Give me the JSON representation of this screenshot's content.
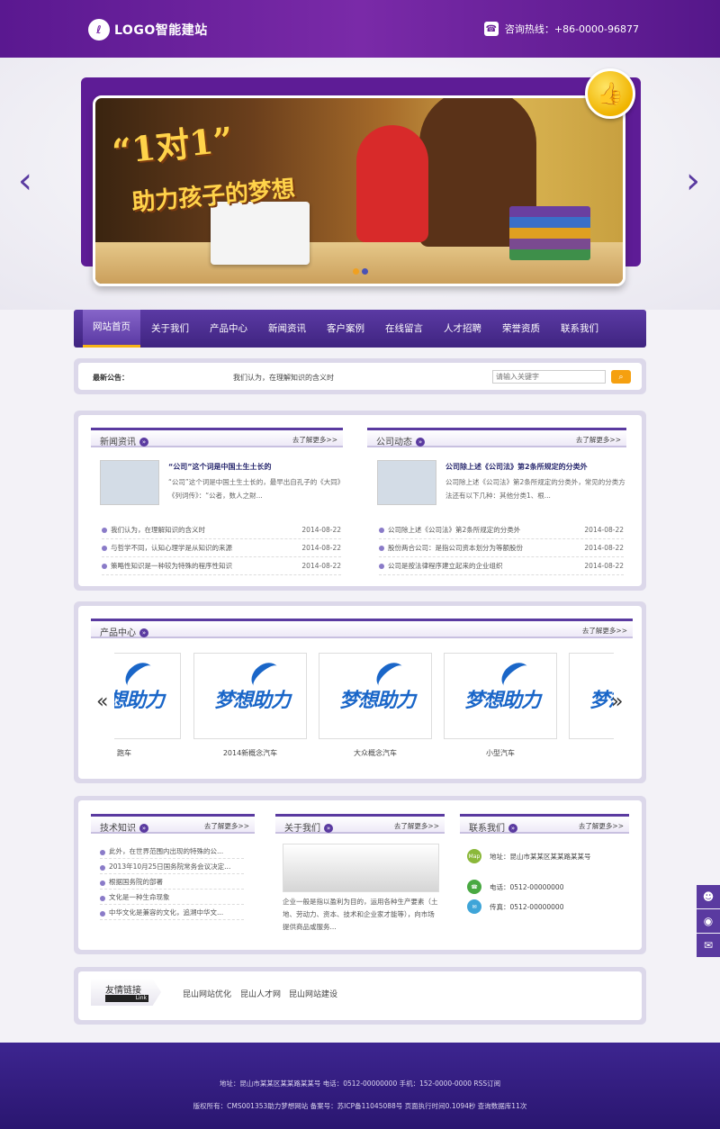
{
  "header": {
    "logo_text": "LOGO智能建站",
    "hotline": "咨询热线：+86-0000-96877"
  },
  "nav": {
    "items": [
      "网站首页",
      "关于我们",
      "产品中心",
      "新闻资讯",
      "客户案例",
      "在线留言",
      "人才招聘",
      "荣誉资质",
      "联系我们"
    ],
    "active": "网站首页"
  },
  "notice": {
    "label": "最新公告：",
    "text": "我们认为，在理解知识的含义时",
    "search_placeholder": "请输入关键字"
  },
  "news": {
    "title": "新闻资讯",
    "more": "去了解更多>>",
    "feature_title": "“公司”这个词是中国土生土长的",
    "feature_desc": "“公司”这个词是中国土生土长的，最早出自孔子的《大同》《列词传》：“公者，数人之財...",
    "items": [
      {
        "text": "我们认为，在理解知识的含义时",
        "date": "2014-08-22"
      },
      {
        "text": "与哲学不同，认知心理学是从知识的来源",
        "date": "2014-08-22"
      },
      {
        "text": "策略性知识是一种较为特殊的程序性知识",
        "date": "2014-08-22"
      }
    ]
  },
  "company": {
    "title": "公司动态",
    "more": "去了解更多>>",
    "feature_title": "公司除上述《公司法》第2条所规定的分类外",
    "feature_desc": "公司除上述《公司法》第2条所规定的分类外，常见的分类方法还有以下几种：其他分类1、根...",
    "items": [
      {
        "text": "公司除上述《公司法》第2条所规定的分类外",
        "date": "2014-08-22"
      },
      {
        "text": "股份两合公司：是指公司资本划分为等额股份",
        "date": "2014-08-22"
      },
      {
        "text": "公司是按法律程序建立起来的企业组织",
        "date": "2014-08-22"
      }
    ]
  },
  "products": {
    "title": "产品中心",
    "more": "去了解更多>>",
    "logo_text": "梦想助力",
    "items": [
      "跑车",
      "2014新概念汽车",
      "大众概念汽车",
      "小型汽车"
    ]
  },
  "tech": {
    "title": "技术知识",
    "more": "去了解更多>>",
    "items": [
      "此外，在世界范围内出现的特殊的公...",
      "2013年10月25日国务院常务会议决定...",
      "根据国务院的部署",
      "文化是一种生命现象",
      "中华文化是兼容的文化，追溯中华文..."
    ]
  },
  "about": {
    "title": "关于我们",
    "more": "去了解更多>>",
    "text": "企业一般是指以盈利为目的，运用各种生产要素（土地、劳动力、资本、技术和企业家才能等），向市场提供商品或服务..."
  },
  "contact": {
    "title": "联系我们",
    "more": "去了解更多>>",
    "address": "地址：昆山市某某区某某路某某号",
    "phone": "电话：0512-00000000",
    "fax": "传真：0512-00000000",
    "map_label": "Map"
  },
  "links": {
    "title": "友情链接",
    "subtitle": "Link",
    "items": [
      "昆山网站优化",
      "昆山人才网",
      "昆山网站建设"
    ]
  },
  "footer": {
    "line1": "地址：昆山市某某区某某路某某号 电话：0512-00000000 手机：152-0000-0000 RSS订阅",
    "line2": "版权所有：CMS001353助力梦想网站 备案号：苏ICP备11045088号 页面执行时间0.1094秒 查询数据库11次"
  },
  "colors": {
    "brand_purple": "#5a3aa0",
    "accent_orange": "#f5a010",
    "header_purple": "#7a2aa8"
  }
}
